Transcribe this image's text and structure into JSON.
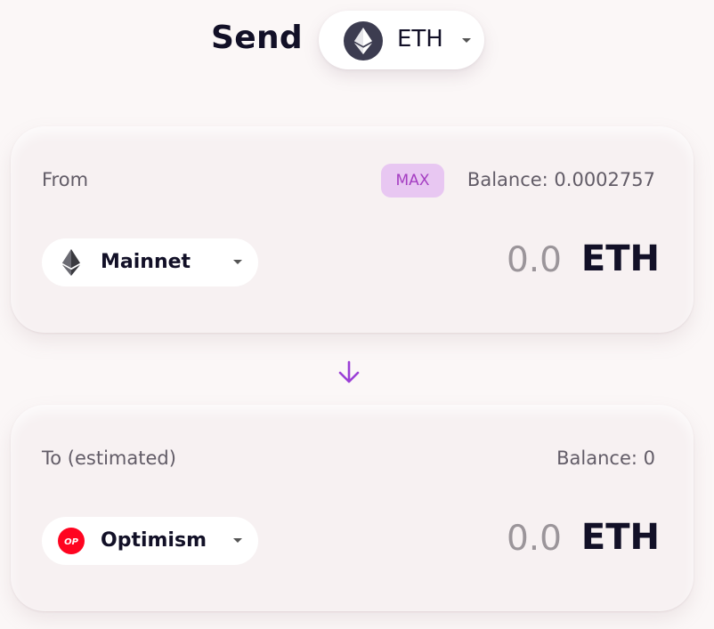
{
  "header": {
    "title": "Send",
    "token": {
      "symbol": "ETH",
      "icon": "eth-icon"
    }
  },
  "from": {
    "label": "From",
    "max_label": "MAX",
    "balance": "Balance: 0.0002757",
    "network": {
      "name": "Mainnet",
      "icon": "eth-icon"
    },
    "amount": "0.0",
    "currency": "ETH"
  },
  "to": {
    "label": "To (estimated)",
    "balance": "Balance: 0",
    "network": {
      "name": "Optimism",
      "icon": "optimism-icon",
      "badge": "OP"
    },
    "amount": "0.0",
    "currency": "ETH"
  },
  "switch_icon": "arrow-down-icon",
  "colors": {
    "accent": "#9b3fd6",
    "max_bg": "#e8c7f2",
    "max_text": "#a53ec2",
    "optimism_red": "#ff0420",
    "eth_dark": "#3c3c50"
  }
}
